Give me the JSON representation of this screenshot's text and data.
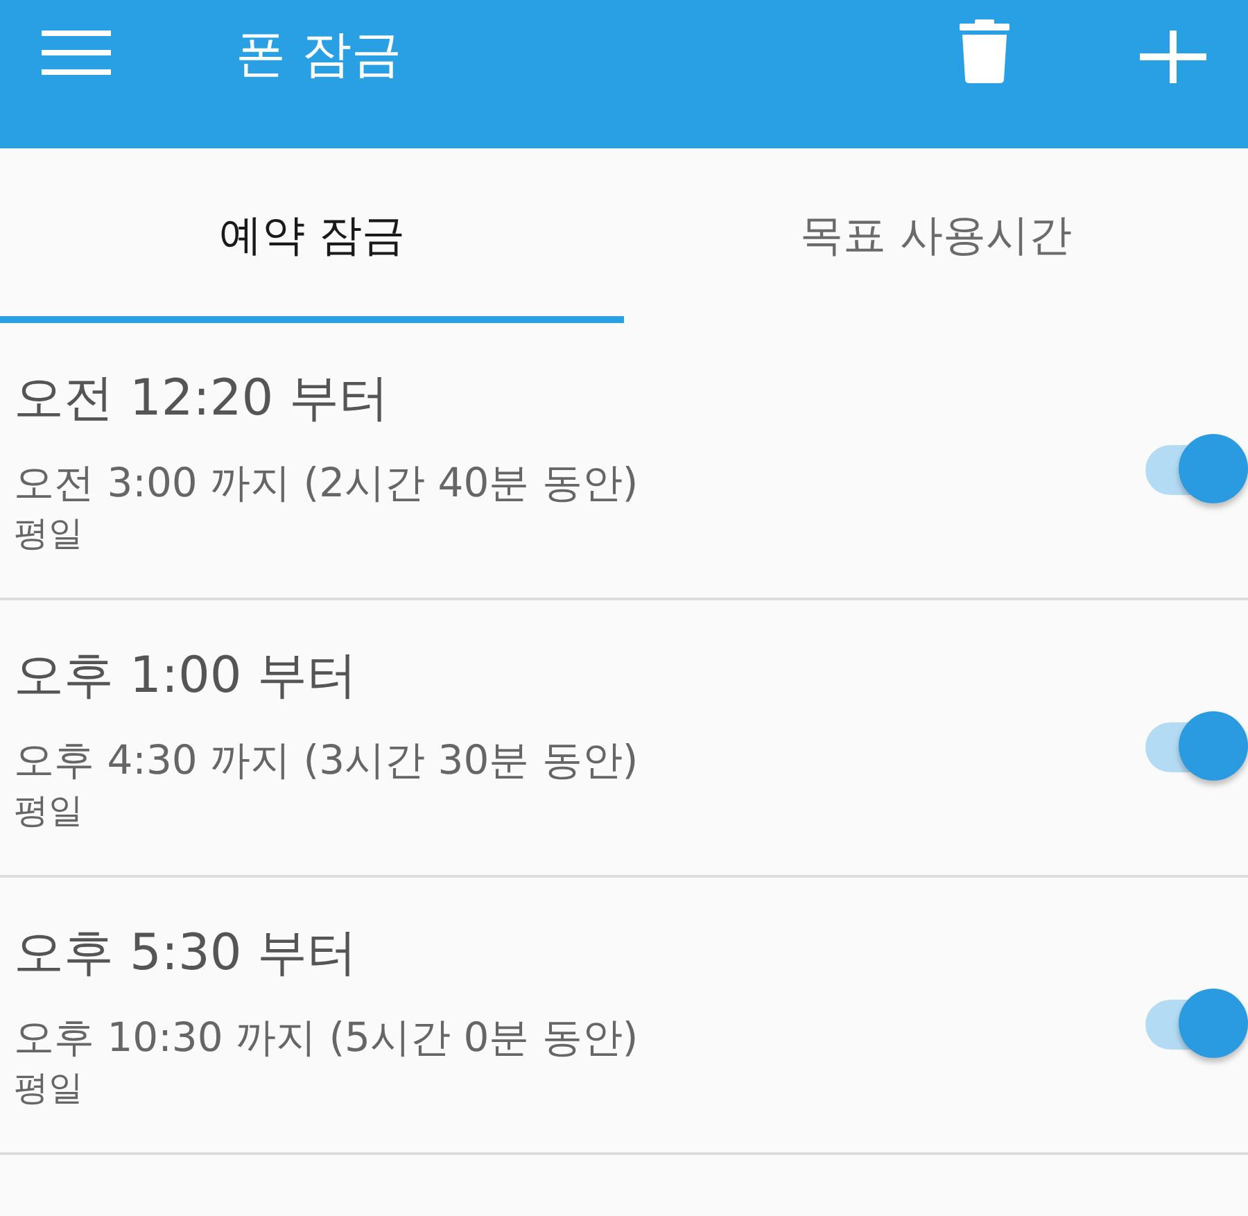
{
  "app_bar": {
    "title": "폰 잠금"
  },
  "tabs": [
    {
      "label": "예약 잠금",
      "selected": true
    },
    {
      "label": "목표 사용시간",
      "selected": false
    }
  ],
  "schedules": [
    {
      "start": "오전 12:20 부터",
      "end": "오전 3:00 까지 (2시간 40분 동안)",
      "days": "평일",
      "on": true
    },
    {
      "start": "오후 1:00 부터",
      "end": "오후 4:30 까지 (3시간 30분 동안)",
      "days": "평일",
      "on": true
    },
    {
      "start": "오후 5:30 부터",
      "end": "오후 10:30 까지 (5시간 0분 동안)",
      "days": "평일",
      "on": true
    }
  ]
}
